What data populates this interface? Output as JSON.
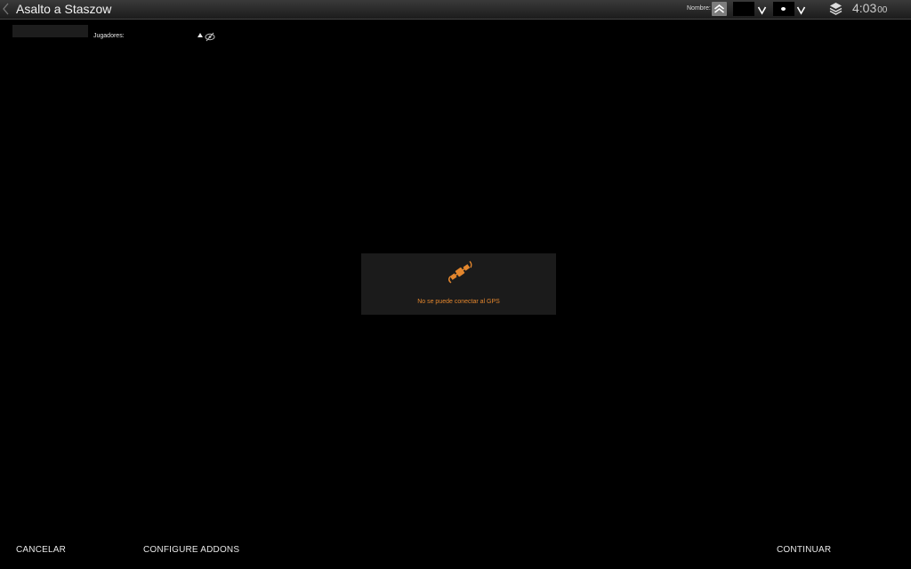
{
  "header": {
    "title": "Asalto a Staszow",
    "nombre_label": "Nombre:",
    "clock_main": "4:03",
    "clock_seconds": "00"
  },
  "players": {
    "label": "Jugadores:"
  },
  "gps": {
    "message": "No se puede conectar al GPS",
    "accent": "#e3862d"
  },
  "footer": {
    "cancel": "CANCELAR",
    "configure_addons": "CONFIGURE ADDONS",
    "continue": "CONTINUAR"
  }
}
